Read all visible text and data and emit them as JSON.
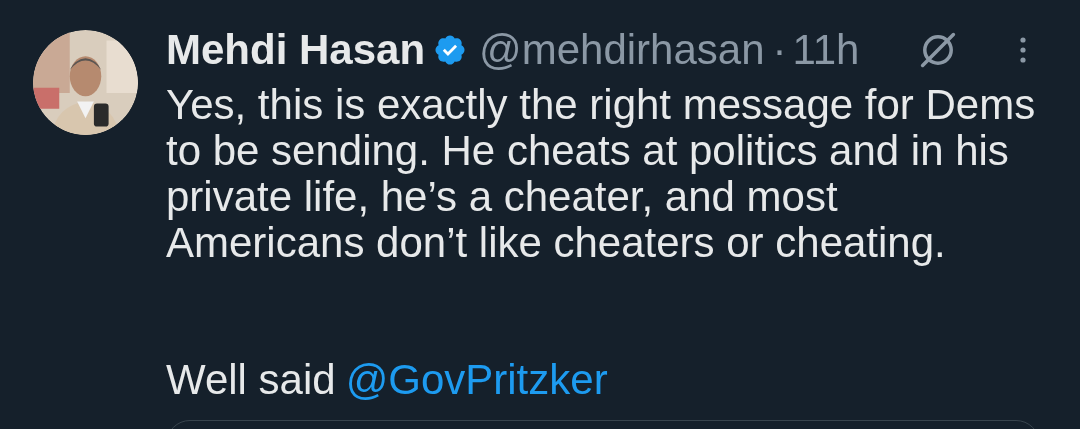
{
  "author": {
    "name": "Mehdi Hasan",
    "verified": true,
    "handle": "@mehdirhasan",
    "separator": "·",
    "time": "11h"
  },
  "body": {
    "text": "Yes, this is exactly the right message for Dems\nto be sending. He cheats at politics and in his\nprivate life, he’s a cheater, and most\nAmericans don’t like cheaters or cheating.",
    "closing": "Well said",
    "mention": "@GovPritzker"
  }
}
